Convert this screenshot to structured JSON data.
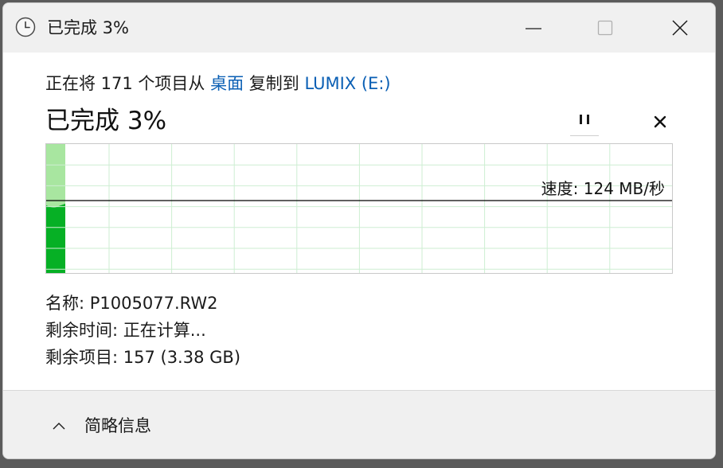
{
  "titlebar": {
    "title": "已完成 3%",
    "icon": "clock-icon"
  },
  "copy": {
    "prefix": "正在将 171 个项目从 ",
    "source": "桌面",
    "middle": " 复制到 ",
    "destination": "LUMIX (E:)"
  },
  "status": {
    "percent_text": "已完成 3%",
    "progress": 0.03
  },
  "graph": {
    "speed_label": "速度: 124 MB/秒",
    "speed_level": 0.44,
    "colors": {
      "done": "#06b025",
      "done_light": "#a8e6a0",
      "grid": "#cdeed2"
    }
  },
  "details": {
    "name": "名称: P1005077.RW2",
    "time_left": "剩余时间: 正在计算...",
    "items_left": "剩余项目: 157 (3.38 GB)"
  },
  "footer": {
    "toggle_label": "简略信息",
    "toggle_icon": "chevron-up-icon"
  }
}
